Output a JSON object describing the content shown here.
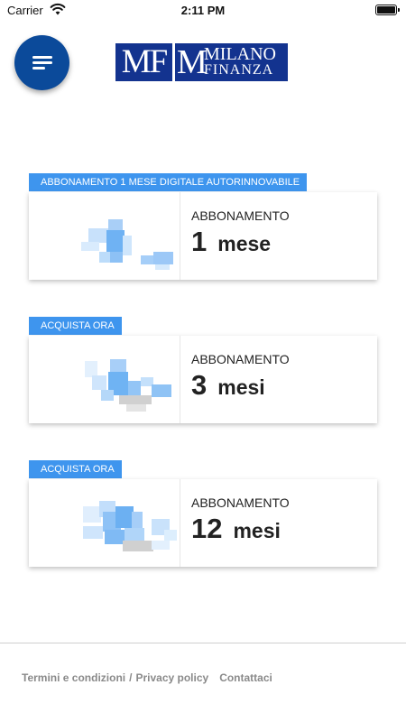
{
  "status_bar": {
    "carrier": "Carrier",
    "time": "2:11 PM",
    "wifi_icon": "wifi-icon",
    "battery_icon": "battery-icon"
  },
  "header": {
    "menu_icon": "hamburger-menu-icon",
    "logo": {
      "mark": "MF",
      "line1": "MILANO",
      "line2": "FINANZA",
      "color": "#13338f"
    }
  },
  "colors": {
    "accent": "#0b4a9a",
    "tag": "#3e95ee"
  },
  "offers": [
    {
      "tag": "ABBONAMENTO 1 MESE DIGITALE AUTORINNOVABILE",
      "label": "ABBONAMENTO",
      "number": "1",
      "unit": "mese"
    },
    {
      "tag": "ACQUISTA ORA",
      "label": "ABBONAMENTO",
      "number": "3",
      "unit": "mesi"
    },
    {
      "tag": "ACQUISTA ORA",
      "label": "ABBONAMENTO",
      "number": "12",
      "unit": "mesi"
    }
  ],
  "footer": {
    "terms": "Termini e condizioni",
    "separator": "/",
    "privacy": "Privacy policy",
    "contact": "Contattaci"
  }
}
